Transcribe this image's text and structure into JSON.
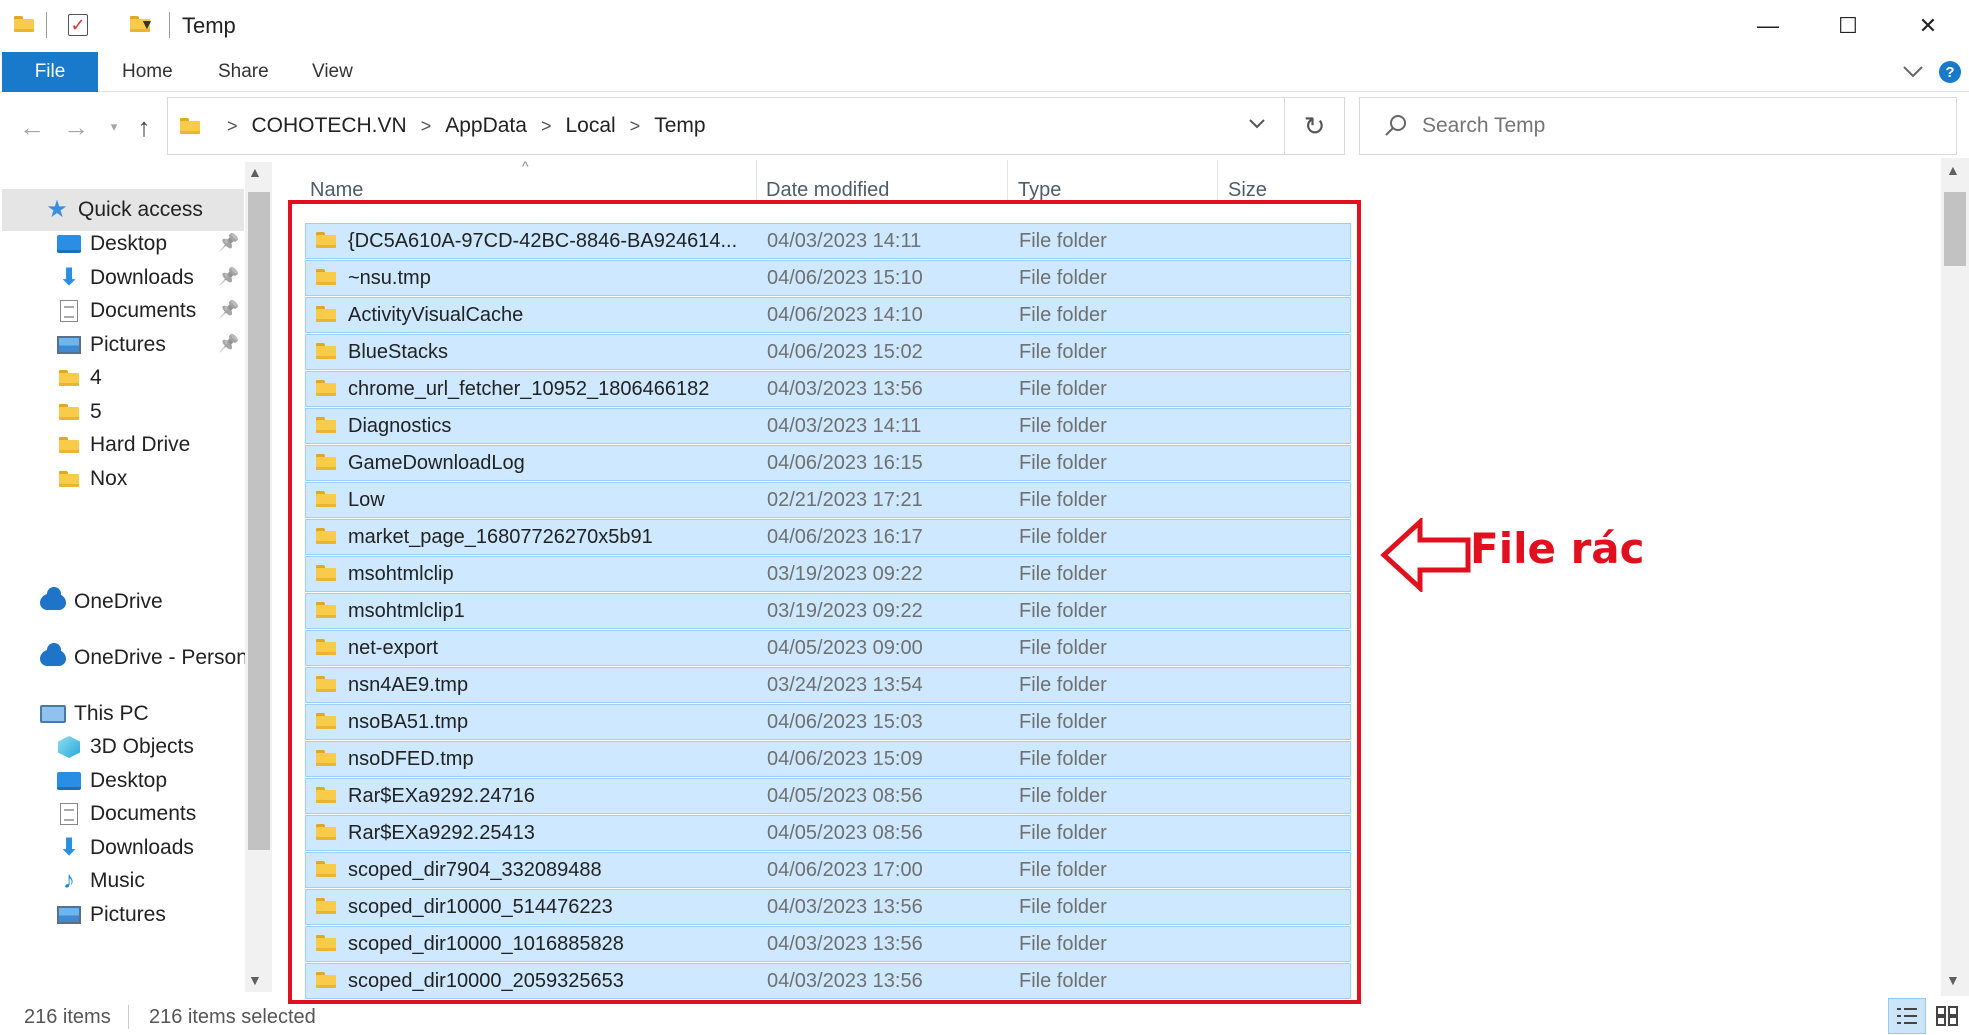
{
  "window": {
    "title": "Temp",
    "controls": {
      "minimize": "—",
      "maximize": "☐",
      "close": "✕"
    }
  },
  "ribbon": {
    "tabs": [
      "File",
      "Home",
      "Share",
      "View"
    ],
    "expand_icon": "chevron-down-icon",
    "help_icon": "help-icon"
  },
  "address": {
    "crumbs": [
      "COHOTECH.VN",
      "AppData",
      "Local",
      "Temp"
    ],
    "refresh": "↻"
  },
  "search": {
    "placeholder": "Search Temp"
  },
  "nav": {
    "quick_access": "Quick access",
    "quick_items": [
      {
        "label": "Desktop",
        "icon": "desktop-icon",
        "pinned": true
      },
      {
        "label": "Downloads",
        "icon": "download-icon",
        "pinned": true
      },
      {
        "label": "Documents",
        "icon": "document-icon",
        "pinned": true
      },
      {
        "label": "Pictures",
        "icon": "pictures-icon",
        "pinned": true
      },
      {
        "label": "4",
        "icon": "folder-icon",
        "pinned": false
      },
      {
        "label": "5",
        "icon": "folder-icon",
        "pinned": false
      },
      {
        "label": "Hard Drive",
        "icon": "folder-icon",
        "pinned": false
      },
      {
        "label": "Nox",
        "icon": "folder-icon",
        "pinned": false
      }
    ],
    "onedrive": "OneDrive",
    "onedrive_personal": "OneDrive - Person",
    "this_pc": "This PC",
    "pc_items": [
      {
        "label": "3D Objects",
        "icon": "3d-objects-icon"
      },
      {
        "label": "Desktop",
        "icon": "desktop-icon"
      },
      {
        "label": "Documents",
        "icon": "document-icon"
      },
      {
        "label": "Downloads",
        "icon": "download-icon"
      },
      {
        "label": "Music",
        "icon": "music-icon"
      },
      {
        "label": "Pictures",
        "icon": "pictures-icon"
      }
    ]
  },
  "columns": {
    "name": "Name",
    "date": "Date modified",
    "type": "Type",
    "size": "Size"
  },
  "files": [
    {
      "name": "{DC5A610A-97CD-42BC-8846-BA924614...",
      "date": "04/03/2023 14:11",
      "type": "File folder"
    },
    {
      "name": "~nsu.tmp",
      "date": "04/06/2023 15:10",
      "type": "File folder"
    },
    {
      "name": "ActivityVisualCache",
      "date": "04/06/2023 14:10",
      "type": "File folder"
    },
    {
      "name": "BlueStacks",
      "date": "04/06/2023 15:02",
      "type": "File folder"
    },
    {
      "name": "chrome_url_fetcher_10952_1806466182",
      "date": "04/03/2023 13:56",
      "type": "File folder"
    },
    {
      "name": "Diagnostics",
      "date": "04/03/2023 14:11",
      "type": "File folder"
    },
    {
      "name": "GameDownloadLog",
      "date": "04/06/2023 16:15",
      "type": "File folder"
    },
    {
      "name": "Low",
      "date": "02/21/2023 17:21",
      "type": "File folder"
    },
    {
      "name": "market_page_16807726270x5b91",
      "date": "04/06/2023 16:17",
      "type": "File folder"
    },
    {
      "name": "msohtmlclip",
      "date": "03/19/2023 09:22",
      "type": "File folder"
    },
    {
      "name": "msohtmlclip1",
      "date": "03/19/2023 09:22",
      "type": "File folder"
    },
    {
      "name": "net-export",
      "date": "04/05/2023 09:00",
      "type": "File folder"
    },
    {
      "name": "nsn4AE9.tmp",
      "date": "03/24/2023 13:54",
      "type": "File folder"
    },
    {
      "name": "nsoBA51.tmp",
      "date": "04/06/2023 15:03",
      "type": "File folder"
    },
    {
      "name": "nsoDFED.tmp",
      "date": "04/06/2023 15:09",
      "type": "File folder"
    },
    {
      "name": "Rar$EXa9292.24716",
      "date": "04/05/2023 08:56",
      "type": "File folder"
    },
    {
      "name": "Rar$EXa9292.25413",
      "date": "04/05/2023 08:56",
      "type": "File folder"
    },
    {
      "name": "scoped_dir7904_332089488",
      "date": "04/06/2023 17:00",
      "type": "File folder"
    },
    {
      "name": "scoped_dir10000_514476223",
      "date": "04/03/2023 13:56",
      "type": "File folder"
    },
    {
      "name": "scoped_dir10000_1016885828",
      "date": "04/03/2023 13:56",
      "type": "File folder"
    },
    {
      "name": "scoped_dir10000_2059325653",
      "date": "04/03/2023 13:56",
      "type": "File folder"
    }
  ],
  "annotation": {
    "text": "File rác",
    "color": "#e0101e"
  },
  "status": {
    "items": "216 items",
    "selected": "216 items selected"
  },
  "colors": {
    "accent": "#1979ca",
    "selection": "#cde8ff",
    "selection_border": "#9ad0fb"
  }
}
